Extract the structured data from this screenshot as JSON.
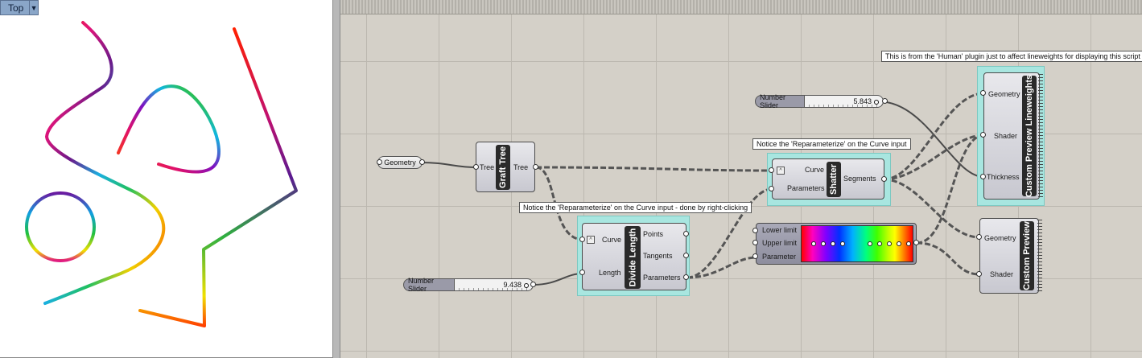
{
  "viewport": {
    "label": "Top",
    "dropdown_icon": "triangle-down-icon"
  },
  "canvas": {
    "notes": {
      "human_plugin": "This is from the 'Human' plugin just to affect lineweights for displaying this script",
      "shatter": "Notice the 'Reparameterize' on the Curve input",
      "divide": "Notice the 'Reparameterize' on the Curve input - done by right-clicking"
    },
    "geometry_param": "Geometry",
    "graft_tree": {
      "title": "Graft Tree",
      "input": "Tree",
      "output": "Tree"
    },
    "shatter": {
      "title": "Shatter",
      "inputs": [
        "Curve",
        "Parameters"
      ],
      "output": "Segments"
    },
    "divide_length": {
      "title": "Divide Length",
      "inputs": [
        "Curve",
        "Length"
      ],
      "outputs": [
        "Points",
        "Tangents",
        "Parameters"
      ]
    },
    "gradient": {
      "inputs": [
        "Lower limit",
        "Upper limit",
        "Parameter"
      ]
    },
    "slider_thickness": {
      "name": "Number Slider",
      "value": "5.843"
    },
    "slider_length": {
      "name": "Number Slider",
      "value": "9.438"
    },
    "preview_lineweights": {
      "title": "Custom Preview Lineweights",
      "inputs": [
        "Geometry",
        "Shader",
        "Thickness"
      ]
    },
    "preview": {
      "title": "Custom Preview",
      "inputs": [
        "Geometry",
        "Shader"
      ]
    }
  },
  "colors": {
    "canvas_bg": "#d4d0c8",
    "highlight": "#a8e6e0",
    "viewport_label": "#8aa6c8"
  }
}
